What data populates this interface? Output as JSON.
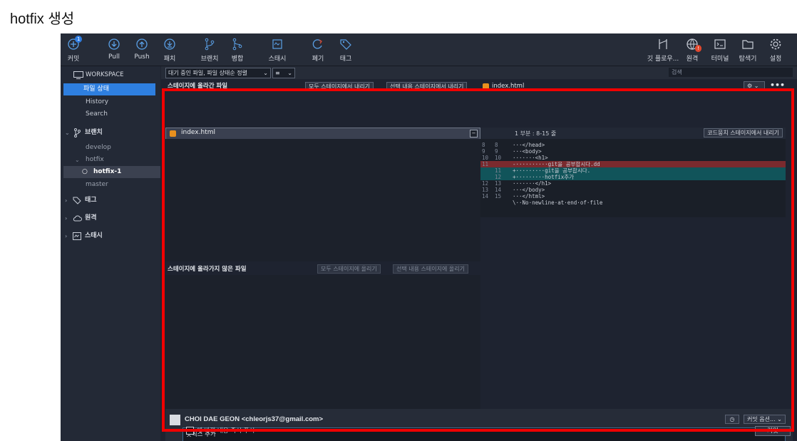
{
  "heading": "hotfix 생성",
  "toolbar": {
    "commit": "커밋",
    "commit_badge": "1",
    "pull": "Pull",
    "push": "Push",
    "fetch": "패치",
    "branch": "브랜치",
    "merge": "병합",
    "stash": "스태시",
    "discard": "폐기",
    "tag": "태그",
    "gitflow": "깃 플로우...",
    "remote": "원격",
    "remote_badge": "!",
    "terminal": "터미널",
    "explorer": "탐색기",
    "settings": "설정"
  },
  "sidebar": {
    "workspace": "WORKSPACE",
    "file_status": "파일 상태",
    "history": "History",
    "search": "Search",
    "branches": "브랜치",
    "develop": "develop",
    "hotfix": "hotfix",
    "hotfix_1": "hotfix-1",
    "master": "master",
    "tags": "태그",
    "remotes": "원격",
    "stashes": "스태시"
  },
  "topbar": {
    "filter": "대기 중인 파일, 파일 상태순 정렬",
    "search_placeholder": "검색"
  },
  "staged": {
    "title": "스테이지에 올라간 파일",
    "unstage_all": "모두 스테이지에서 내리기",
    "unstage_selected": "선택 내용 스테이지에서 내리기",
    "file": "index.html"
  },
  "diff": {
    "file": "index.html",
    "hunk": "1 부분 : 8-15 줄",
    "unstage_hunk": "코드뭉치 스테이지에서 내리기",
    "lines": [
      {
        "o": "8",
        "n": "8",
        "code": "···</head>",
        "type": "ctx"
      },
      {
        "o": "9",
        "n": "9",
        "code": "···<body>",
        "type": "ctx"
      },
      {
        "o": "10",
        "n": "10",
        "code": "·······<h1>",
        "type": "ctx"
      },
      {
        "o": "11",
        "n": "",
        "code": "-··········git을 공부합시다.dd",
        "type": "del"
      },
      {
        "o": "",
        "n": "11",
        "code": "+·········git을 공부합시다.",
        "type": "add"
      },
      {
        "o": "",
        "n": "12",
        "code": "+·········hotfix추가",
        "type": "add"
      },
      {
        "o": "12",
        "n": "13",
        "code": "·······</h1>",
        "type": "ctx"
      },
      {
        "o": "13",
        "n": "14",
        "code": "···</body>",
        "type": "ctx"
      },
      {
        "o": "14",
        "n": "15",
        "code": "···</html>",
        "type": "ctx"
      },
      {
        "o": "",
        "n": "",
        "code": "\\··No·newline·at·end·of·file",
        "type": "ctx"
      }
    ]
  },
  "unstaged": {
    "title": "스테이지에 올라가지 않은 파일",
    "stage_all": "모두 스테이지에 올리기",
    "stage_selected": "선택 내용 스테이지에 올리기"
  },
  "commit": {
    "author": "CHOI DAE GEON <chleorjs37@gmail.com>",
    "message": "핫픽스 추가",
    "options": "커밋 옵션...",
    "push_immediately": "-에 바뀐 내용 즉시 푸시",
    "submit": "커밋"
  },
  "colors": {
    "accent": "#2e7fe0",
    "highlight": "#f00000",
    "deleted": "#7a2a2e",
    "added": "#11545a"
  }
}
